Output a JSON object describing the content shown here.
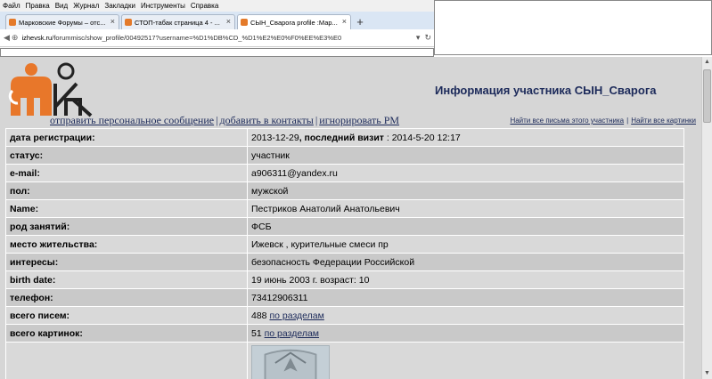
{
  "menu": [
    "Файл",
    "Правка",
    "Вид",
    "Журнал",
    "Закладки",
    "Инструменты",
    "Справка"
  ],
  "tabs": [
    {
      "label": "Марковские Форумы – отс...",
      "active": false
    },
    {
      "label": "СТОП-табак страница 4 - ...",
      "active": false
    },
    {
      "label": "СЫН_Сварога profile :Мар...",
      "active": true
    }
  ],
  "new_tab_symbol": "+",
  "address": {
    "domain": "izhevsk.ru",
    "path": "/forummisc/show_profile/00492517?username=%D1%DB%CD_%D1%E2%E0%F0%EE%E3%E0"
  },
  "page": {
    "title": "Информация участника СЫН_Сварога",
    "actions": [
      "отправить персональное сообщение",
      "добавить в контакты",
      "игнорировать PM"
    ],
    "right_links": [
      "Найти все письма этого участника",
      "Найти все картинки"
    ]
  },
  "profile": [
    {
      "label": "дата регистрации:",
      "value": "2013-12-29",
      "extra_label": ", последний визит",
      "extra_value": ": 2014-5-20 12:17"
    },
    {
      "label": "статус:",
      "value": "участник"
    },
    {
      "label": "e-mail:",
      "value": "a906311@yandex.ru"
    },
    {
      "label": "пол:",
      "value": "мужской"
    },
    {
      "label": "Name:",
      "value": "Пестриков Анатолий Анатольевич"
    },
    {
      "label": "род занятий:",
      "value": "ФСБ"
    },
    {
      "label": "место жительства:",
      "value": "Ижевск , курительные смеси пр"
    },
    {
      "label": "интересы:",
      "value": "безопасность Федерации Российской"
    },
    {
      "label": "birth date:",
      "value": "19 июнь 2003 г. возраст: 10"
    },
    {
      "label": "телефон:",
      "value": "73412906311"
    },
    {
      "label": "всего писем:",
      "value": "488",
      "link": "по разделам"
    },
    {
      "label": "всего картинок:",
      "value": "51",
      "link": "по разделам"
    }
  ],
  "colors": {
    "link": "#1c2a5a",
    "page_bg": "#d6d6d6",
    "logo_orange": "#e8772a"
  }
}
